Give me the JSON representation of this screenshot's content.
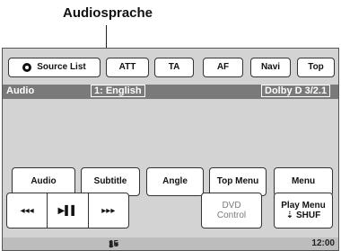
{
  "callout": {
    "title": "Audiosprache"
  },
  "top_bar": {
    "source_list": "Source List",
    "att": "ATT",
    "ta": "TA",
    "af": "AF",
    "navi": "Navi",
    "top": "Top"
  },
  "status": {
    "label": "Audio",
    "language": "1: English",
    "format": "Dolby D 3/2.1"
  },
  "buttons": {
    "audio": "Audio",
    "subtitle": "Subtitle",
    "angle": "Angle",
    "top_menu": "Top Menu",
    "menu": "Menu"
  },
  "transport": {
    "prev": "◂◂◂",
    "play_pause": "▶▌▌",
    "next": "▸▸▸"
  },
  "dvd_control": {
    "line1": "DVD",
    "line2": "Control"
  },
  "play_menu": {
    "line1": "Play Menu",
    "line2": "⇣ SHUF"
  },
  "footer": {
    "track": "15",
    "clock": "12:00"
  },
  "colors": {
    "panel": "#d3d3d3",
    "status_bar": "#7a7a7a",
    "footer": "#bdbdbd"
  }
}
